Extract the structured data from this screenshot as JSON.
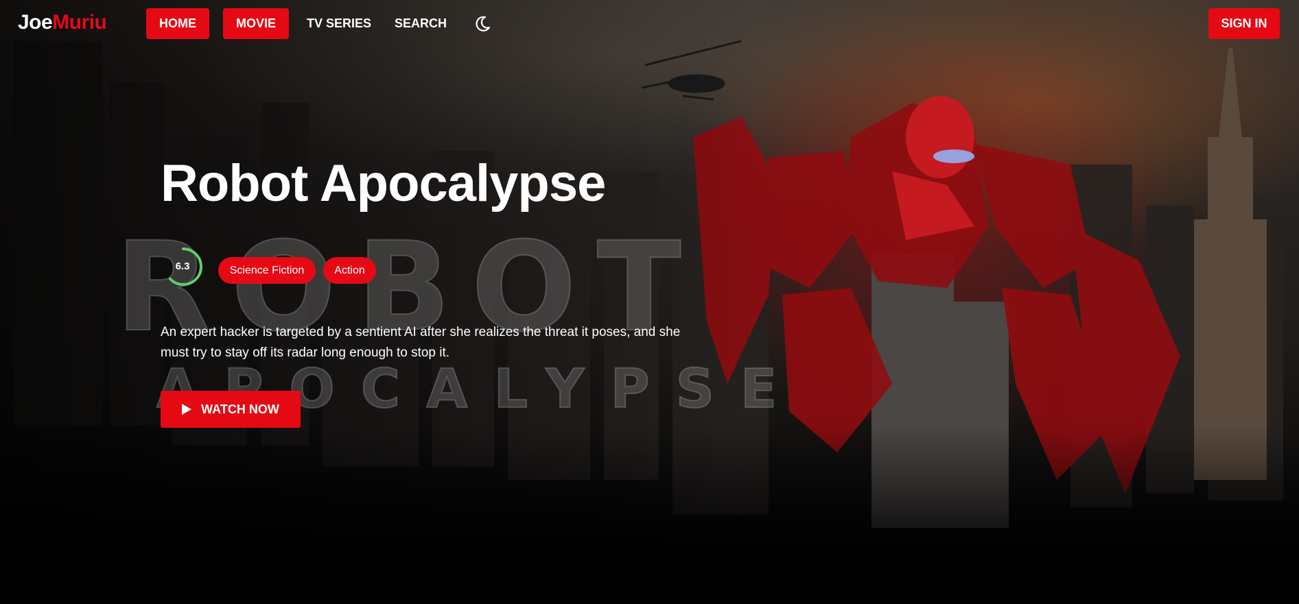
{
  "brand": {
    "part1": "Joe",
    "part2": "Muriu"
  },
  "nav": {
    "home": "HOME",
    "movie": "MOVIE",
    "tv_series": "TV SERIES",
    "search": "SEARCH",
    "sign_in": "SIGN IN",
    "theme_icon": "moon-icon"
  },
  "hero": {
    "title": "Robot Apocalypse",
    "rating": "6.3",
    "rating_fraction": 0.63,
    "genres": [
      "Science Fiction",
      "Action"
    ],
    "description": "An expert hacker is targeted by a sentient AI after she realizes the threat it poses, and she must try to stay off its radar long enough to stop it.",
    "watch_label": "WATCH NOW",
    "poster_text": {
      "line1": "ROBOT",
      "line2": "APOCALYPSE"
    }
  },
  "colors": {
    "accent": "#e50914",
    "rating_ring": "#5fd068",
    "text": "#ffffff"
  }
}
